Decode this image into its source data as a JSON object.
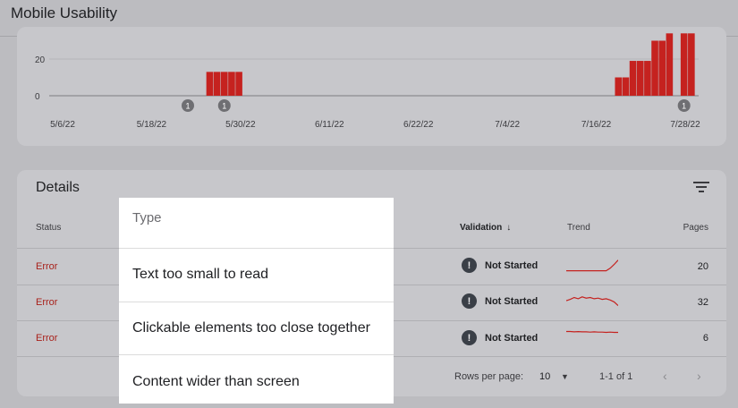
{
  "page": {
    "title": "Mobile Usability"
  },
  "chart_data": {
    "type": "bar",
    "xlabel": "",
    "ylabel": "",
    "yticks": [
      0,
      20
    ],
    "x_tick_labels": [
      "5/6/22",
      "5/18/22",
      "5/30/22",
      "6/11/22",
      "6/22/22",
      "7/4/22",
      "7/16/22",
      "7/28/22"
    ],
    "categories": [
      "5/28/22",
      "5/29/22",
      "5/30/22",
      "5/31/22",
      "6/1/22",
      "7/23/22",
      "7/24/22",
      "7/25/22",
      "7/26/22",
      "7/27/22",
      "7/28/22",
      "7/29/22",
      "7/30/22",
      "7/31/22",
      "8/1/22",
      "8/2/22"
    ],
    "values": [
      13,
      13,
      13,
      13,
      13,
      10,
      10,
      19,
      19,
      19,
      30,
      30,
      34,
      0,
      34,
      34
    ],
    "color": "#c5221f",
    "annotations": [
      {
        "date": "5/25/22",
        "label": "1"
      },
      {
        "date": "5/30/22",
        "label": "1"
      },
      {
        "date": "8/1/22",
        "label": "1"
      }
    ],
    "grid": true
  },
  "details": {
    "title": "Details",
    "columns": {
      "status": "Status",
      "validation": "Validation",
      "validation_sort_icon": "↓",
      "trend": "Trend",
      "pages": "Pages"
    },
    "rows": [
      {
        "status": "Error",
        "validation": "Not Started",
        "pages": "20",
        "trend": [
          0.1,
          0.1,
          0.1,
          0.1,
          0.1,
          0.1,
          0.1,
          0.1,
          0.1,
          0.1,
          0.1,
          0.3,
          0.6,
          0.95
        ]
      },
      {
        "status": "Error",
        "validation": "Not Started",
        "pages": "32",
        "trend": [
          0.5,
          0.6,
          0.75,
          0.65,
          0.8,
          0.7,
          0.75,
          0.65,
          0.7,
          0.6,
          0.65,
          0.55,
          0.4,
          0.1
        ]
      },
      {
        "status": "Error",
        "validation": "Not Started",
        "pages": "6",
        "trend": [
          0.75,
          0.75,
          0.72,
          0.74,
          0.72,
          0.72,
          0.7,
          0.72,
          0.7,
          0.7,
          0.68,
          0.7,
          0.68,
          0.68
        ]
      }
    ],
    "footer": {
      "rows_per_page_label": "Rows per page:",
      "rows_per_page_value": "10",
      "range": "1-1 of 1"
    }
  },
  "type_menu": {
    "header": "Type",
    "items": [
      "Text too small to read",
      "Clickable elements too close together",
      "Content wider than screen"
    ]
  },
  "icons": {
    "filter": "filter-icon",
    "alert": "alert-circle-icon",
    "dropdown": "caret-down-icon",
    "prev": "chevron-left-icon",
    "next": "chevron-right-icon"
  }
}
